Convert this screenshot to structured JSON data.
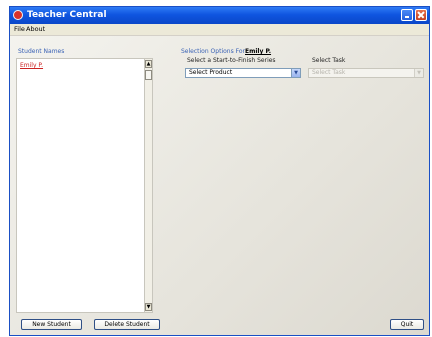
{
  "window": {
    "title": "Teacher Central"
  },
  "menu": {
    "file": "File",
    "about": "About"
  },
  "students": {
    "header": "Student Names",
    "items": [
      "Emily P."
    ]
  },
  "selection": {
    "label": "Selection Options For:",
    "student": "Emily P."
  },
  "series": {
    "label": "Select a Start-to-Finish Series",
    "selected": "Select Product"
  },
  "task": {
    "label": "Select Task",
    "selected": "Select Task"
  },
  "buttons": {
    "new_student": "New Student",
    "delete_student": "Delete Student",
    "quit": "Quit"
  },
  "icons": {
    "scroll_up": "▲",
    "scroll_down": "▼",
    "dropdown": "▼"
  },
  "colors": {
    "title_bar": "#0f55e0",
    "link_label": "#3a62b5",
    "selected_student": "#cc2222"
  }
}
